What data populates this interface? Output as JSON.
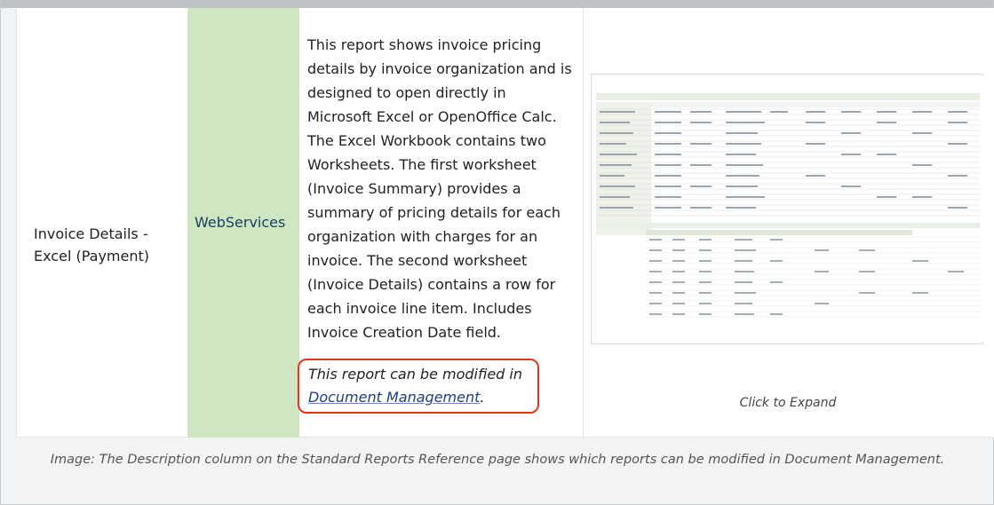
{
  "row": {
    "report_name": "Invoice Details - Excel (Payment)",
    "source": "WebServices",
    "description": "This report shows invoice pricing details by invoice organization and is designed to open directly in Microsoft Excel or OpenOffice Calc. The Excel Workbook contains two Worksheets. The first worksheet (Invoice Summary) provides a summary of pricing details for each organization with charges for an invoice. The second worksheet (Invoice Details) contains a row for each invoice line item. Includes Invoice Creation Date field.",
    "note_prefix": "This report can be modified in",
    "note_link": "Document Management",
    "note_suffix": ".",
    "thumbnail_label": "Click to Expand"
  },
  "caption": "Image: The Description column on the Standard Reports Reference page shows which reports can be modified in Document Management.",
  "colors": {
    "source_cell_bg": "#cfe6c3",
    "highlight_border": "#e0341e",
    "link": "#1d3f8a"
  }
}
